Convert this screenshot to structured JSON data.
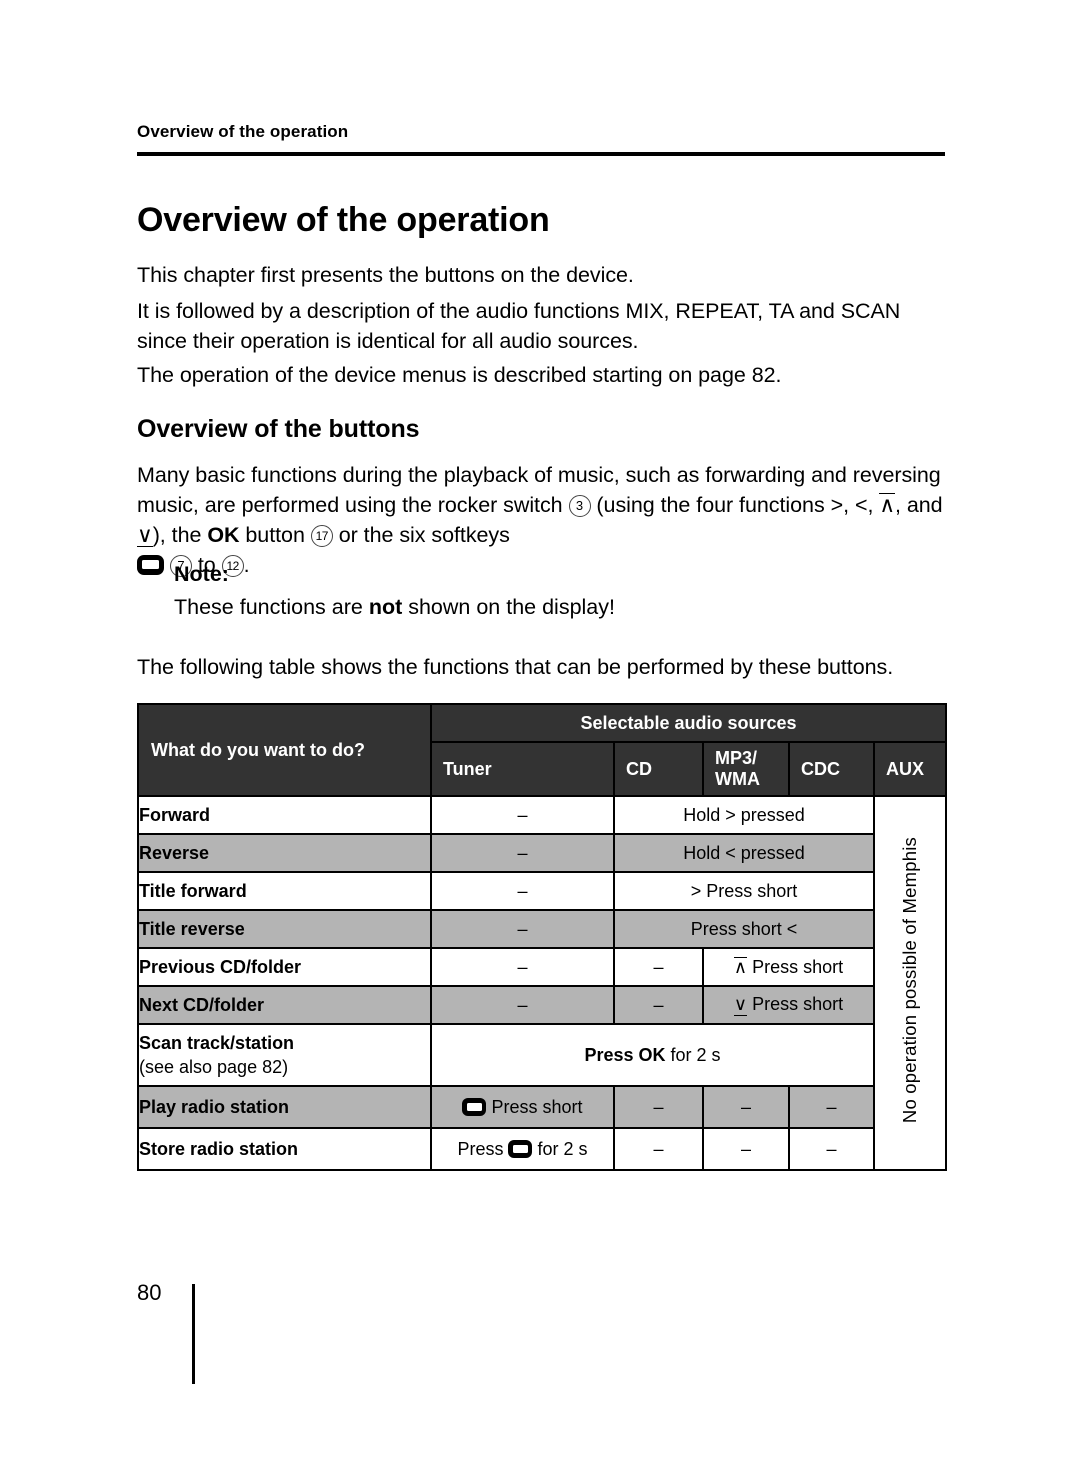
{
  "running_head": "Overview of the operation",
  "headings": {
    "h1": "Overview of the operation",
    "h2": "Overview of the buttons"
  },
  "paragraphs": {
    "p1": "This chapter first presents the buttons on the device.",
    "p2": "It is followed by a description of the audio functions MIX, REPEAT, TA and SCAN since their operation is identical for all audio sources.",
    "p3": "The operation of the device menus is described starting on page 82.",
    "p4_a": "Many basic functions during the playback of music, such as forwarding and reversing music, are performed using the rocker switch ",
    "p4_ref1": "3",
    "p4_b": " (using the four functions ",
    "p4_sym1": ">",
    "p4_c": ", ",
    "p4_sym2": "<",
    "p4_d": ", ",
    "p4_sym3": "∧",
    "p4_e": ", and ",
    "p4_sym4": "∨",
    "p4_f": "), the ",
    "p4_ok": "OK",
    "p4_g": " button ",
    "p4_ref2": "17",
    "p4_h": " or the six softkeys ",
    "p4_ref3": "7",
    "p4_i": " to ",
    "p4_ref4": "12",
    "p4_j": ".",
    "note_title": "Note:",
    "note_body_a": "These functions are ",
    "note_body_bold": "not",
    "note_body_b": " shown on the display!",
    "p5": "The following table shows the functions that can be performed by these buttons."
  },
  "table": {
    "header": {
      "question": "What do you want to do?",
      "group": "Selectable audio sources",
      "sources": [
        "Tuner",
        "CD",
        "MP3/\nWMA",
        "CDC",
        "AUX"
      ],
      "source_tuner": "Tuner",
      "source_cd": "CD",
      "source_mp3_line1": "MP3/",
      "source_mp3_line2": "WMA",
      "source_cdc": "CDC",
      "source_aux": "AUX"
    },
    "aux_note": "No operation possible of Memphis",
    "rows": [
      {
        "label": "Forward",
        "sublabel": "",
        "shade": "white",
        "tuner": "–",
        "merged": "Hold > pressed",
        "merged_prefix": "Hold ",
        "merged_symbol": ">",
        "merged_suffix": " pressed"
      },
      {
        "label": "Reverse",
        "sublabel": "",
        "shade": "gray",
        "tuner": "–",
        "merged_prefix": "Hold ",
        "merged_symbol": "<",
        "merged_suffix": " pressed"
      },
      {
        "label": "Title forward",
        "sublabel": "",
        "shade": "white",
        "tuner": "–",
        "merged_prefix": "",
        "merged_symbol": ">",
        "merged_suffix": " Press short"
      },
      {
        "label": "Title reverse",
        "sublabel": "",
        "shade": "gray",
        "tuner": "–",
        "merged_prefix": "Press short ",
        "merged_symbol": "<",
        "merged_suffix": ""
      },
      {
        "label": "Previous CD/folder",
        "sublabel": "",
        "shade": "white",
        "tuner": "–",
        "cd": "–",
        "merged_symbol": "∧",
        "merged_suffix": " Press short"
      },
      {
        "label": "Next CD/folder",
        "sublabel": "",
        "shade": "gray",
        "tuner": "–",
        "cd": "–",
        "merged_symbol": "∨",
        "merged_suffix": " Press short"
      },
      {
        "label": "Scan track/station",
        "sublabel": "(see also page 82)",
        "shade": "white",
        "merged_bold": "Press OK",
        "merged_rest": " for 2 s"
      },
      {
        "label": "Play radio station",
        "sublabel": "",
        "shade": "gray",
        "tuner_icon": "softkey-icon",
        "tuner_text": "Press short",
        "cd": "–",
        "mp3": "–",
        "cdc": "–"
      },
      {
        "label": "Store radio station",
        "sublabel": "",
        "shade": "white",
        "tuner_pre": "Press ",
        "tuner_icon": "softkey-icon",
        "tuner_post": " for 2 s",
        "cd": "–",
        "mp3": "–",
        "cdc": "–"
      }
    ]
  },
  "footer": {
    "page_number": "80"
  },
  "colors": {
    "header_bg": "#333333",
    "row_gray": "#b4b4b4",
    "text": "#000000"
  }
}
